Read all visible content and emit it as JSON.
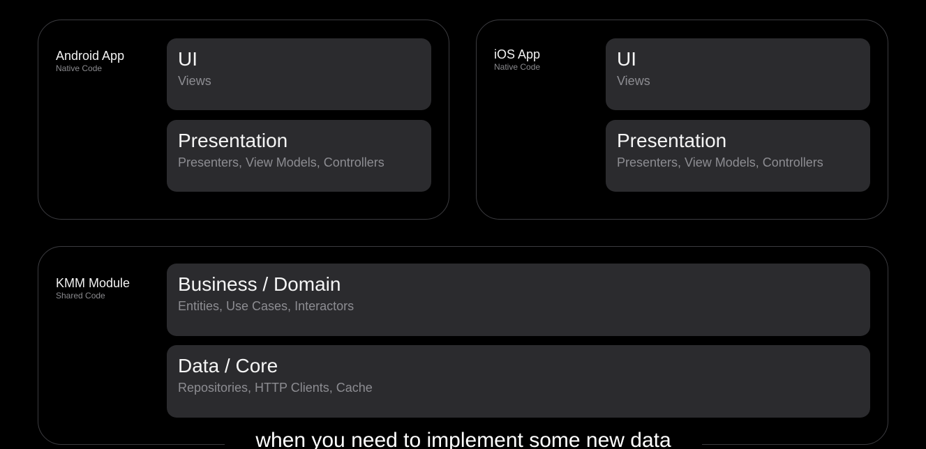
{
  "android": {
    "title": "Android App",
    "subtitle": "Native Code",
    "layers": [
      {
        "title": "UI",
        "desc": "Views"
      },
      {
        "title": "Presentation",
        "desc": "Presenters, View Models, Controllers"
      }
    ]
  },
  "ios": {
    "title": "iOS App",
    "subtitle": "Native Code",
    "layers": [
      {
        "title": "UI",
        "desc": "Views"
      },
      {
        "title": "Presentation",
        "desc": "Presenters, View Models, Controllers"
      }
    ]
  },
  "kmm": {
    "title": "KMM Module",
    "subtitle": "Shared Code",
    "layers": [
      {
        "title": "Business / Domain",
        "desc": "Entities, Use Cases, Interactors"
      },
      {
        "title": "Data / Core",
        "desc": "Repositories, HTTP Clients, Cache"
      }
    ]
  },
  "caption": "when you need to implement some new data",
  "colors": {
    "background": "#000000",
    "card": "#2b2b2e",
    "border": "#3c3c40",
    "muted_text": "#8d8d92"
  }
}
